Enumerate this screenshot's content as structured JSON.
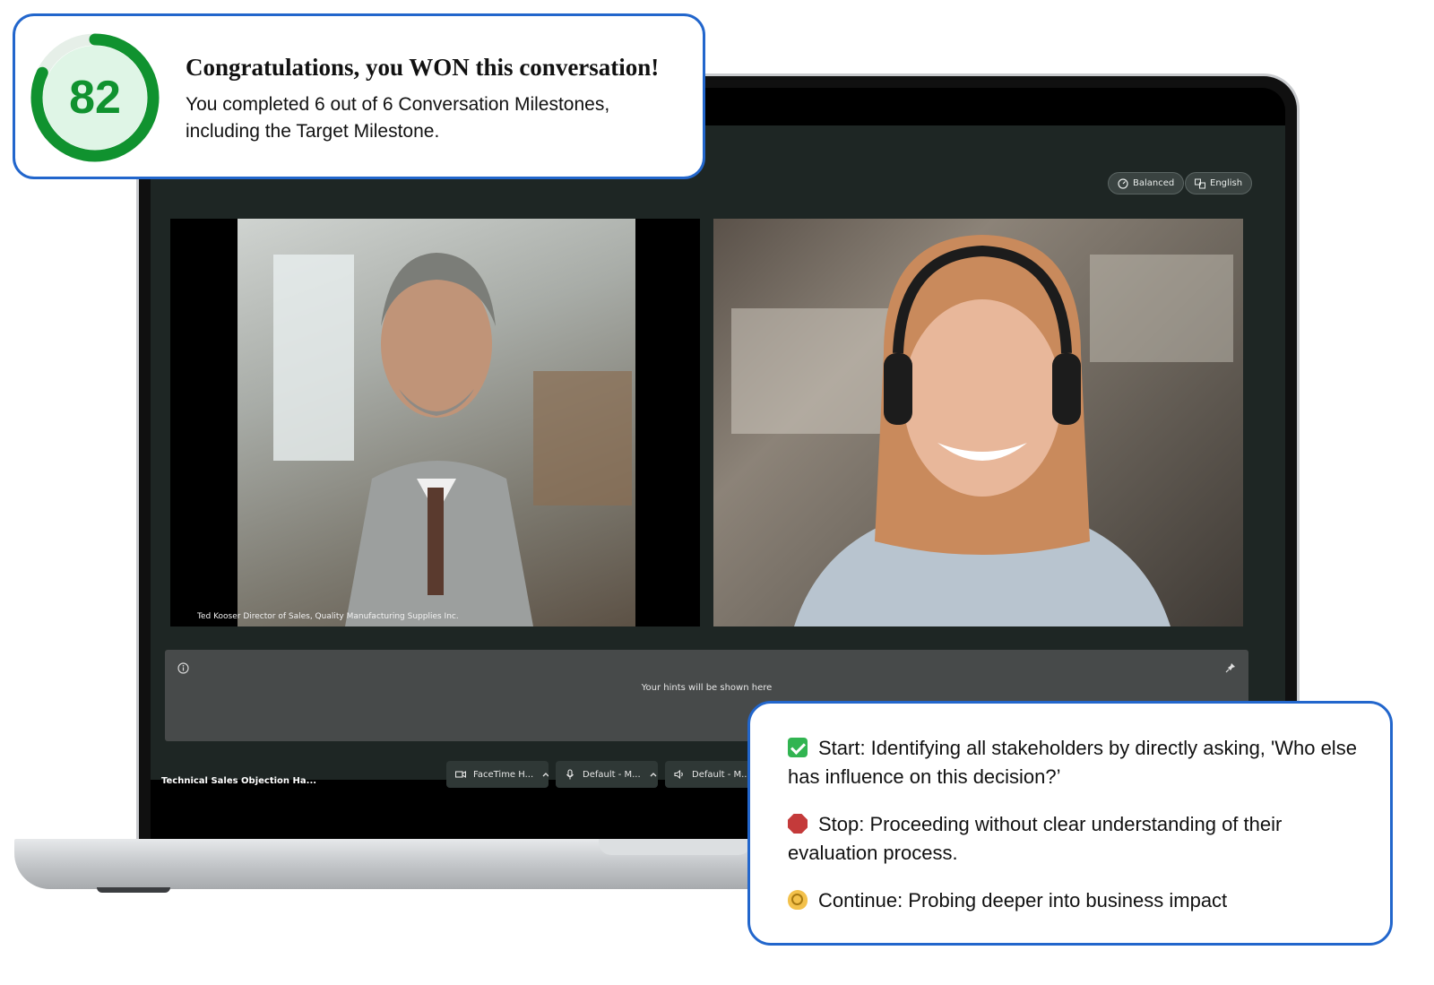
{
  "score": {
    "value": "82",
    "progress_fraction": 0.82,
    "title": "Congratulations, you WON this conversation!",
    "subtitle": "You completed 6 out of 6 Conversation Milestones, including the Target Milestone.",
    "ring_color": "#10922f"
  },
  "top_controls": {
    "mode_label": "Balanced",
    "language_label": "English"
  },
  "videos": {
    "left_caption": "Ted Kooser Director of Sales, Quality Manufacturing Supplies Inc."
  },
  "hints": {
    "placeholder": "Your hints will be shown here"
  },
  "bottom_bar": {
    "meeting_title": "Technical Sales Objection Ha...",
    "camera_label": "FaceTime H...",
    "mic_label": "Default - M...",
    "speaker_label": "Default - M..."
  },
  "feedback": {
    "start": "Start: Identifying all stakeholders by directly asking, 'Who else has influence on this decision?’",
    "stop": "Stop: Proceeding without clear understanding of their evaluation process.",
    "continue": "Continue: Probing deeper into business impact",
    "start_icon": "check-icon",
    "stop_icon": "stop-sign-icon",
    "continue_icon": "ok-hand-icon"
  }
}
